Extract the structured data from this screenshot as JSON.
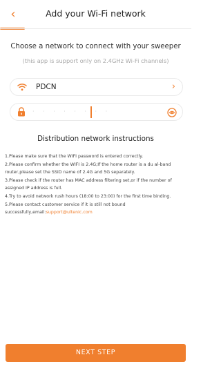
{
  "header": {
    "title": "Add your Wi-Fi network",
    "back_icon": "chevron-left-icon"
  },
  "intro": {
    "subtitle": "Choose a network to connect with your sweeper",
    "note": "(this app is support only on 2.4GHz Wi-Fi channels)"
  },
  "ssid_field": {
    "value": "PDCN",
    "icon": "wifi-icon",
    "trailing_icon": "chevron-right-icon"
  },
  "password_field": {
    "masked_value": "· · · · · · · ·",
    "icon": "lock-icon",
    "trailing_icon": "eye-icon"
  },
  "instructions": {
    "title": "Distribution network instructions",
    "items": [
      "1.Please make sure that the WIFI password is entered correctly.",
      "2.Please confirm whether the WIFI is 2.4G;If the home router is a du al-band router,please set the SSID name of 2.4G and 5G separately.",
      "3.Please check if the router has MAC address filtering set,or if the number of assigned IP address is full.",
      "4.Try to avoid network rush hours (18:00 to 23:00) for the first time binding.",
      "5.Please contact customer service if it is still not bound successfully,email:"
    ],
    "email": "support@ultenic.com"
  },
  "footer": {
    "next_label": "NEXT STEP"
  },
  "colors": {
    "accent": "#f07f2e",
    "text": "#333333",
    "muted": "#a8a8a8",
    "border": "#eaeaea"
  }
}
